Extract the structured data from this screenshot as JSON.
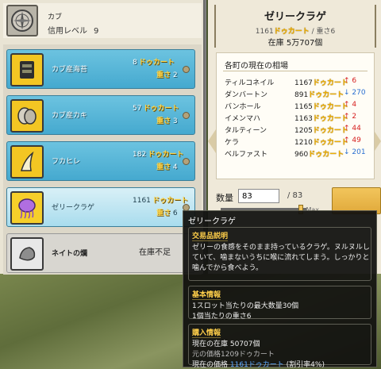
{
  "guild": {
    "name": "カブ",
    "trust_label": "信用レベル",
    "trust_value": "9"
  },
  "items": [
    {
      "name": "カブ産海苔",
      "price": "8",
      "unit": "ドゥカート",
      "weight_label": "重さ",
      "weight": "2",
      "icon": "seaweed-icon"
    },
    {
      "name": "カブ産カキ",
      "price": "57",
      "unit": "ドゥカート",
      "weight_label": "重さ",
      "weight": "3",
      "icon": "oyster-icon"
    },
    {
      "name": "フカヒレ",
      "price": "182",
      "unit": "ドゥカート",
      "weight_label": "重さ",
      "weight": "4",
      "icon": "shark-fin-icon"
    },
    {
      "name": "ゼリークラゲ",
      "price": "1161",
      "unit": "ドゥカート",
      "weight_label": "重さ",
      "weight": "6",
      "icon": "jellyfish-icon"
    },
    {
      "name": "ネイトの爛",
      "status": "在庫不足",
      "icon": "stone-icon"
    }
  ],
  "detail": {
    "title": "ゼリークラゲ",
    "price": "1161",
    "unit": "ドゥカート",
    "weight_label": "重さ",
    "weight": "6",
    "stock_label": "在庫",
    "stock_value": "5万707個"
  },
  "market": {
    "title": "各町の現在の相場",
    "unit": "ドゥカート",
    "rows": [
      {
        "town": "ティルコネイル",
        "price": "1167",
        "change": "6",
        "dir": "up"
      },
      {
        "town": "ダンバートン",
        "price": "891",
        "change": "270",
        "dir": "down"
      },
      {
        "town": "バンホール",
        "price": "1165",
        "change": "4",
        "dir": "up"
      },
      {
        "town": "イメンマハ",
        "price": "1163",
        "change": "2",
        "dir": "up"
      },
      {
        "town": "タルティーン",
        "price": "1205",
        "change": "44",
        "dir": "up"
      },
      {
        "town": "ケラ",
        "price": "1210",
        "change": "49",
        "dir": "up"
      },
      {
        "town": "ベルファスト",
        "price": "960",
        "change": "201",
        "dir": "down"
      }
    ]
  },
  "quantity": {
    "label": "数量",
    "value": "83",
    "max": "/ 83",
    "slider_max": "Max",
    "slider_fraction": 1.0
  },
  "tooltip": {
    "title": "ゼリークラゲ",
    "desc_head": "交易品説明",
    "desc": "ゼリーの食感をそのまま持っているクラゲ。ヌルヌルしていて、噛まないうちに喉に流れてしまう。しっかりと噛んでから食べよう。",
    "basic_head": "基本情報",
    "basic_line1": "1スロット当たりの最大数量30個",
    "basic_line2": "1個当たりの重さ6",
    "buy_head": "購入情報",
    "buy_stock": "現在の在庫 50707個",
    "buy_orig_label": "元の価格",
    "buy_orig_value": "1209ドゥカート",
    "buy_now_label": "現在の価格",
    "buy_now_value": "1161ドゥカート",
    "buy_discount": "(割引率4%)"
  },
  "colors": {
    "item_blue": "#45a9cf",
    "gold": "#f0b000",
    "up": "#d62020",
    "down": "#2a6fd1"
  }
}
